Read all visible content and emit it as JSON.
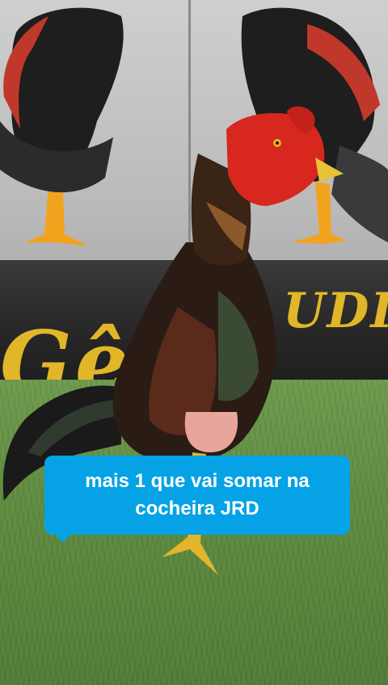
{
  "caption": {
    "text": "mais 1 que vai somar na cocheira JRD"
  },
  "background_logo": {
    "line1": "UDIC",
    "line2": "Gê  os"
  },
  "icons": {
    "photo_subject": "rooster-photo",
    "backdrop_art": "rooster-illustration-icon"
  },
  "colors": {
    "caption_bg": "#05a2e5",
    "caption_text": "#ffffff",
    "logo_gold": "#e2b629",
    "grass": "#5f8c40"
  }
}
